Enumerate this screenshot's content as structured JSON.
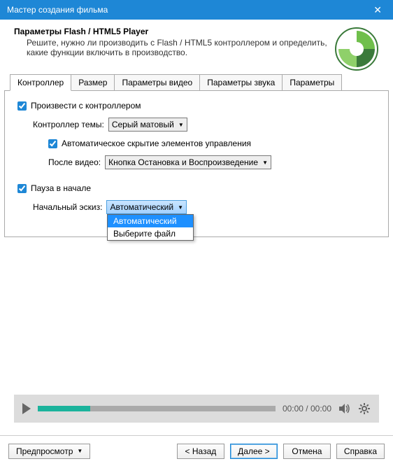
{
  "window": {
    "title": "Мастер создания фильма"
  },
  "header": {
    "title": "Параметры Flash / HTML5 Player",
    "description": "Решите, нужно ли производить с Flash / HTML5 контроллером и определить, какие функции включить в производство."
  },
  "tabs": {
    "controller": "Контроллер",
    "size": "Размер",
    "video_params": "Параметры видео",
    "audio_params": "Параметры звука",
    "params": "Параметры"
  },
  "controller": {
    "produce_with_controller": "Произвести с контроллером",
    "controller_theme_label": "Контроллер темы:",
    "controller_theme_value": "Серый матовый",
    "auto_hide": "Автоматическое скрытие элементов управления",
    "after_video_label": "После видео:",
    "after_video_value": "Кнопка Остановка и Воспроизведение",
    "pause_start": "Пауза в начале",
    "thumb_label": "Начальный эскиз:",
    "thumb_value": "Автоматический",
    "thumb_options": {
      "opt1": "Автоматический",
      "opt2": "Выберите файл"
    }
  },
  "player": {
    "time": "00:00 / 00:00"
  },
  "footer": {
    "preview": "Предпросмотр",
    "back": "< Назад",
    "next": "Далее >",
    "cancel": "Отмена",
    "help": "Справка"
  }
}
